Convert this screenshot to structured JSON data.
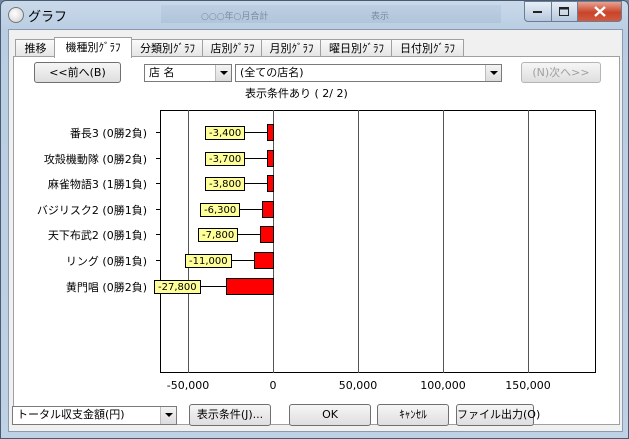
{
  "window": {
    "title": "グラフ"
  },
  "background_window": {
    "text1": "○○○年○月合計",
    "text2": "表示"
  },
  "tabs": [
    "推移",
    "機種別ｸﾞﾗﾌ",
    "分類別ｸﾞﾗﾌ",
    "店別ｸﾞﾗﾌ",
    "月別ｸﾞﾗﾌ",
    "曜日別ｸﾞﾗﾌ",
    "日付別ｸﾞﾗﾌ"
  ],
  "active_tab": 1,
  "nav": {
    "prev_label": "<<前へ(B)",
    "next_label": "(N)次へ>>",
    "field_select": "店 名",
    "store_select": "(全ての店名)",
    "condition": "表示条件あり ( 2/ 2)"
  },
  "chart_data": {
    "type": "bar",
    "orientation": "horizontal",
    "categories": [
      "番長3 (0勝2負)",
      "攻殻機動隊 (0勝2負)",
      "麻雀物語3 (1勝1負)",
      "バジリスク2 (0勝1負)",
      "天下布武2 (0勝1負)",
      "リング (0勝1負)",
      "黄門唱 (0勝2負)"
    ],
    "values": [
      -3400,
      -3700,
      -3800,
      -6300,
      -7800,
      -11000,
      -27800
    ],
    "value_labels": [
      "-3,400",
      "-3,700",
      "-3,800",
      "-6,300",
      "-7,800",
      "-11,000",
      "-27,800"
    ],
    "xlim": [
      -65000,
      190000
    ],
    "xticks": [
      -50000,
      0,
      50000,
      100000,
      150000
    ],
    "xtick_labels": [
      "-50,000",
      "0",
      "50,000",
      "100,000",
      "150,000"
    ],
    "grid": true,
    "bar_color": "#ff0000",
    "label_color": "#ffff99"
  },
  "footer": {
    "metric_select": "トータル収支金額(円)",
    "display_condition_label": "表示条件(J)...",
    "ok_label": "OK",
    "cancel_label": "ｷｬﾝｾﾙ",
    "export_label": "ファイル出力(O)"
  }
}
